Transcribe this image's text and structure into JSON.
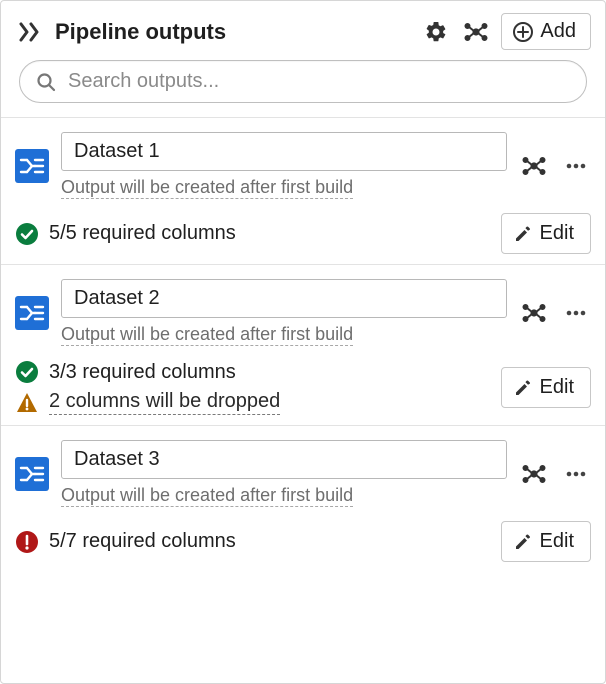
{
  "header": {
    "title": "Pipeline outputs",
    "add_label": "Add"
  },
  "search": {
    "placeholder": "Search outputs..."
  },
  "outputs": [
    {
      "name": "Dataset 1",
      "hint": "Output will be created after first build",
      "status_icon": "check",
      "status_text": "5/5 required columns",
      "warn_text": null,
      "edit_label": "Edit"
    },
    {
      "name": "Dataset 2",
      "hint": "Output will be created after first build",
      "status_icon": "check",
      "status_text": "3/3 required columns",
      "warn_text": "2 columns will be dropped",
      "edit_label": "Edit"
    },
    {
      "name": "Dataset 3",
      "hint": "Output will be created after first build",
      "status_icon": "error",
      "status_text": "5/7 required columns",
      "warn_text": null,
      "edit_label": "Edit"
    }
  ]
}
